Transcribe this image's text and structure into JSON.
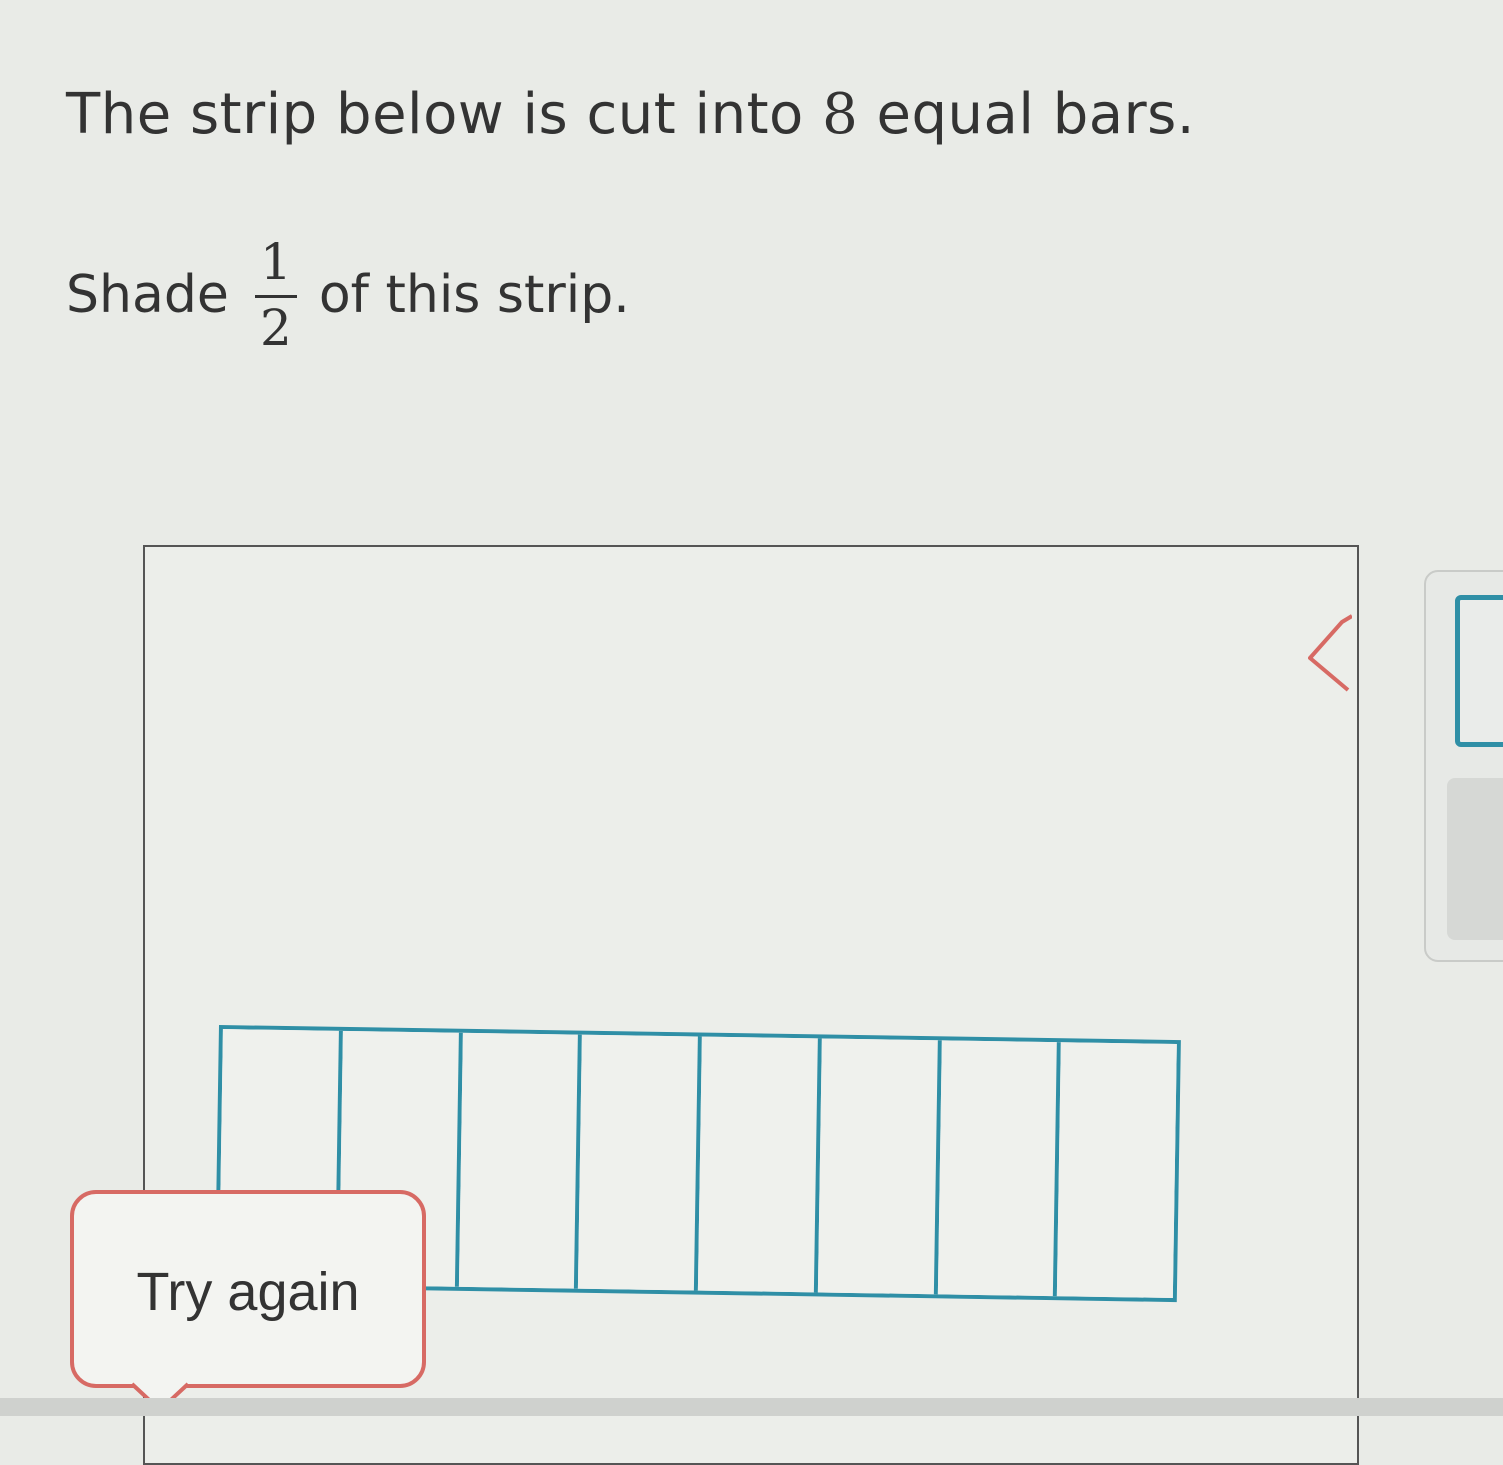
{
  "question": {
    "line1_prefix": "The strip below is cut into ",
    "line1_number": "8",
    "line1_suffix": " equal bars.",
    "line2_prefix": "Shade",
    "fraction_numerator": "1",
    "fraction_denominator": "2",
    "line2_suffix": "of this strip."
  },
  "strip": {
    "bar_count": 8,
    "shaded_bars": 0,
    "bar_color": "#2f8fa6"
  },
  "feedback": {
    "message": "Try again",
    "border_color": "#d76a64"
  },
  "tools": {
    "eraser_icon": "eraser-icon",
    "eraser_color": "#d76a64"
  },
  "colors": {
    "background": "#e9ebe7",
    "text": "#333333",
    "accent": "#2f8fa6"
  }
}
